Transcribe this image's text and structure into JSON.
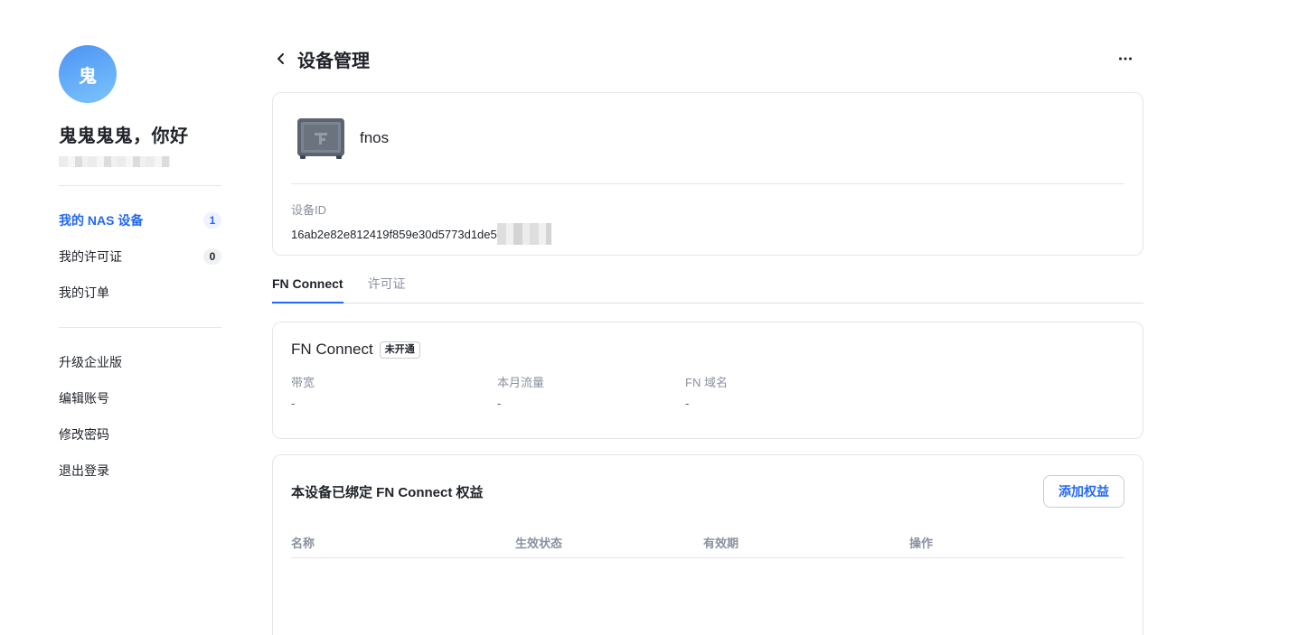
{
  "user": {
    "avatar_text": "鬼",
    "greeting": "鬼鬼鬼鬼，你好"
  },
  "sidebar": {
    "nav": [
      {
        "label": "我的 NAS 设备",
        "count": "1",
        "active": true
      },
      {
        "label": "我的许可证",
        "count": "0",
        "active": false
      },
      {
        "label": "我的订单",
        "count": null,
        "active": false
      }
    ],
    "account_actions": [
      {
        "label": "升级企业版"
      },
      {
        "label": "编辑账号"
      },
      {
        "label": "修改密码"
      },
      {
        "label": "退出登录"
      }
    ]
  },
  "header": {
    "title": "设备管理",
    "back_icon": "chevron-left-icon",
    "more_icon": "more-horizontal-icon"
  },
  "device": {
    "name": "fnos",
    "icon": "nas-device-icon",
    "id_label": "设备ID",
    "id_value": "16ab2e82e812419f859e30d5773d1de5"
  },
  "tabs": [
    {
      "label": "FN Connect",
      "active": true
    },
    {
      "label": "许可证",
      "active": false
    }
  ],
  "connect": {
    "title": "FN Connect",
    "status": "未开通",
    "stats": [
      {
        "label": "带宽",
        "value": "-"
      },
      {
        "label": "本月流量",
        "value": "-"
      },
      {
        "label": "FN 域名",
        "value": "-"
      }
    ]
  },
  "rights": {
    "title": "本设备已绑定 FN Connect 权益",
    "add_button": "添加权益",
    "columns": [
      "名称",
      "生效状态",
      "有效期",
      "操作"
    ]
  },
  "colors": {
    "accent": "#2468f2",
    "text": "#1f2329",
    "muted": "#8a919f",
    "border": "#e5e6eb"
  }
}
